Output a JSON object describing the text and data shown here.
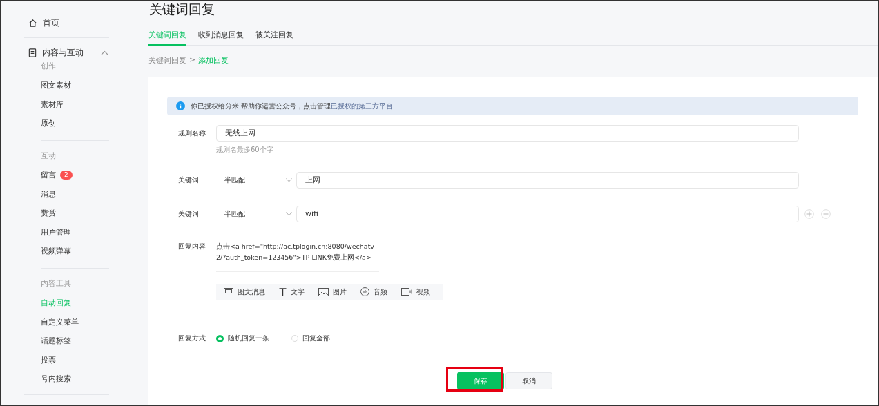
{
  "sidebar": {
    "home": {
      "label": "首页"
    },
    "group": {
      "label": "内容与互动",
      "expanded": true,
      "sections": [
        {
          "title": "创作",
          "items": [
            {
              "label": "图文素材",
              "selected": false
            },
            {
              "label": "素材库",
              "selected": false
            },
            {
              "label": "原创",
              "selected": false
            }
          ]
        },
        {
          "title": "互动",
          "items": [
            {
              "label": "留言",
              "selected": false,
              "badge": "2"
            },
            {
              "label": "消息",
              "selected": false
            },
            {
              "label": "赞赏",
              "selected": false
            },
            {
              "label": "用户管理",
              "selected": false
            },
            {
              "label": "视频弹幕",
              "selected": false
            }
          ]
        },
        {
          "title": "内容工具",
          "items": [
            {
              "label": "自动回复",
              "selected": true
            },
            {
              "label": "自定义菜单",
              "selected": false
            },
            {
              "label": "话题标签",
              "selected": false
            },
            {
              "label": "投票",
              "selected": false
            },
            {
              "label": "号内搜索",
              "selected": false
            }
          ]
        }
      ]
    }
  },
  "page": {
    "title": "关键词回复",
    "tabs": [
      {
        "label": "关键词回复",
        "selected": true
      },
      {
        "label": "收到消息回复",
        "selected": false
      },
      {
        "label": "被关注回复",
        "selected": false
      }
    ],
    "breadcrumb": {
      "parent": "关键词回复",
      "separator": ">",
      "current": "添加回复"
    },
    "notice": {
      "text": "你已授权给分米 帮助你运营公众号，点击管理",
      "link": "已授权的第三方平台"
    },
    "rule_name": {
      "label": "规则名称",
      "value": "无线上网",
      "hint": "规则名最多60个字"
    },
    "keywords": [
      {
        "label": "关键词",
        "match": "半匹配",
        "value": "上网",
        "show_controls": false
      },
      {
        "label": "关键词",
        "match": "半匹配",
        "value": "wifi",
        "show_controls": true
      }
    ],
    "reply_content": {
      "label": "回复内容",
      "text": "点击<a href=\"http://ac.tplogin.cn:8080/wechatv2/?auth_token=123456\">TP-LINK免费上网</a>",
      "media_types": [
        {
          "kind": "news",
          "label": "图文消息"
        },
        {
          "kind": "text",
          "label": "文字"
        },
        {
          "kind": "image",
          "label": "图片"
        },
        {
          "kind": "audio",
          "label": "音频"
        },
        {
          "kind": "video",
          "label": "视频"
        }
      ]
    },
    "reply_mode": {
      "label": "回复方式",
      "options": [
        {
          "label": "随机回复一条",
          "selected": true
        },
        {
          "label": "回复全部",
          "selected": false
        }
      ]
    },
    "actions": [
      {
        "kind": "primary",
        "label": "保存",
        "highlighted": true
      },
      {
        "kind": "secondary",
        "label": "取消",
        "highlighted": false
      }
    ]
  }
}
